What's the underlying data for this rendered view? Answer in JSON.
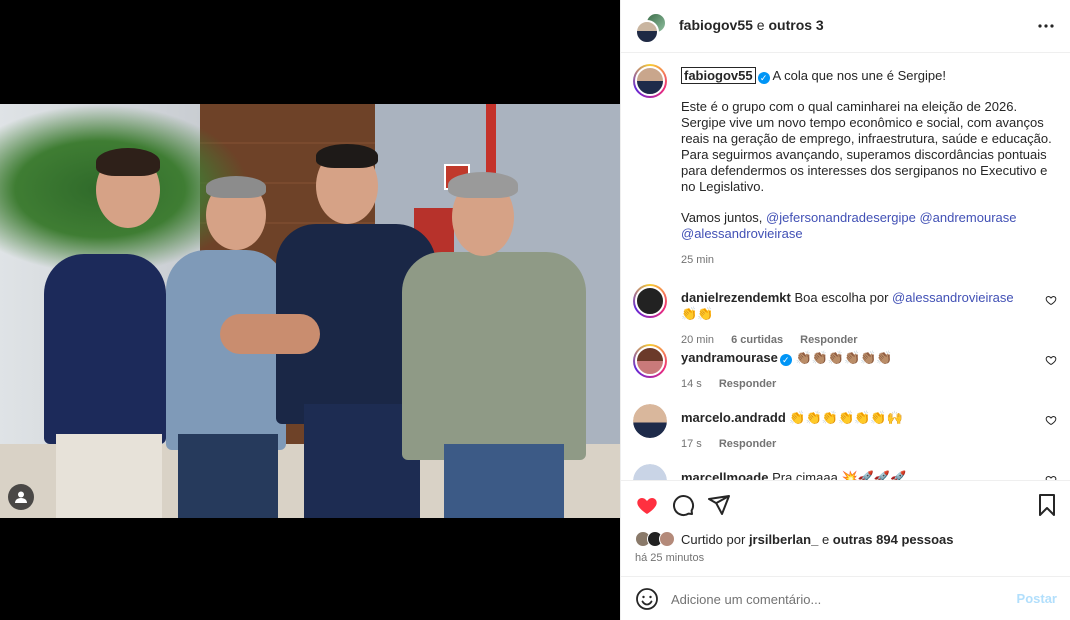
{
  "header": {
    "username": "fabiogov55",
    "joiner": "e",
    "others": "outros 3",
    "more_icon": "more-horizontal-icon"
  },
  "media": {
    "user_tag_icon": "user-tag-icon"
  },
  "caption": {
    "username": "fabiogov55",
    "first_line": "A cola que nos une é Sergipe!",
    "paragraph": "Este é o grupo com o qual caminharei na eleição de 2026. Sergipe vive um novo tempo econômico e social, com avanços reais na geração de emprego, infraestrutura, saúde e educação. Para seguirmos avançando, superamos discordâncias pontuais para defendermos os interesses dos sergipanos no Executivo e no Legislativo.",
    "closing_prefix": "Vamos juntos,",
    "mentions": [
      "@jefersonandradesergipe",
      "@andremourase",
      "@alessandrovieirase"
    ],
    "time": "25 min"
  },
  "comments": [
    {
      "user": "danielrezendemkt",
      "text": "Boa escolha por",
      "mention": "@alessandrovieirase",
      "emoji": "👏👏",
      "time": "20 min",
      "likes": "6 curtidas",
      "reply": "Responder",
      "verified": false
    },
    {
      "user": "yandramourase",
      "text": "",
      "mention": "",
      "emoji": "👏🏽👏🏽👏🏽👏🏽👏🏽👏🏽",
      "time": "14 s",
      "likes": "",
      "reply": "Responder",
      "verified": true
    },
    {
      "user": "marcelo.andradd",
      "text": "",
      "mention": "",
      "emoji": "👏👏👏👏👏👏🙌",
      "time": "17 s",
      "likes": "",
      "reply": "Responder",
      "verified": false
    },
    {
      "user": "marcellmoade",
      "text": "Pra cimaaa",
      "mention": "",
      "emoji": "💥🚀🚀🚀",
      "time": "",
      "likes": "",
      "reply": "",
      "verified": false
    }
  ],
  "actions": {
    "like_icon": "heart-filled-icon",
    "comment_icon": "comment-icon",
    "share_icon": "share-icon",
    "save_icon": "bookmark-icon",
    "liked_by_prefix": "Curtido por",
    "liked_by_user": "jrsilberlan_",
    "liked_by_joiner": "e",
    "liked_by_others": "outras 894 pessoas",
    "post_time": "há 25 minutos"
  },
  "add_comment": {
    "placeholder": "Adicione um comentário...",
    "post_label": "Postar",
    "emoji_icon": "emoji-icon"
  },
  "colors": {
    "like_red": "#ff3040",
    "link_blue": "#4150b5",
    "verified_blue": "#0095f6",
    "post_button": "#b2dffc"
  }
}
